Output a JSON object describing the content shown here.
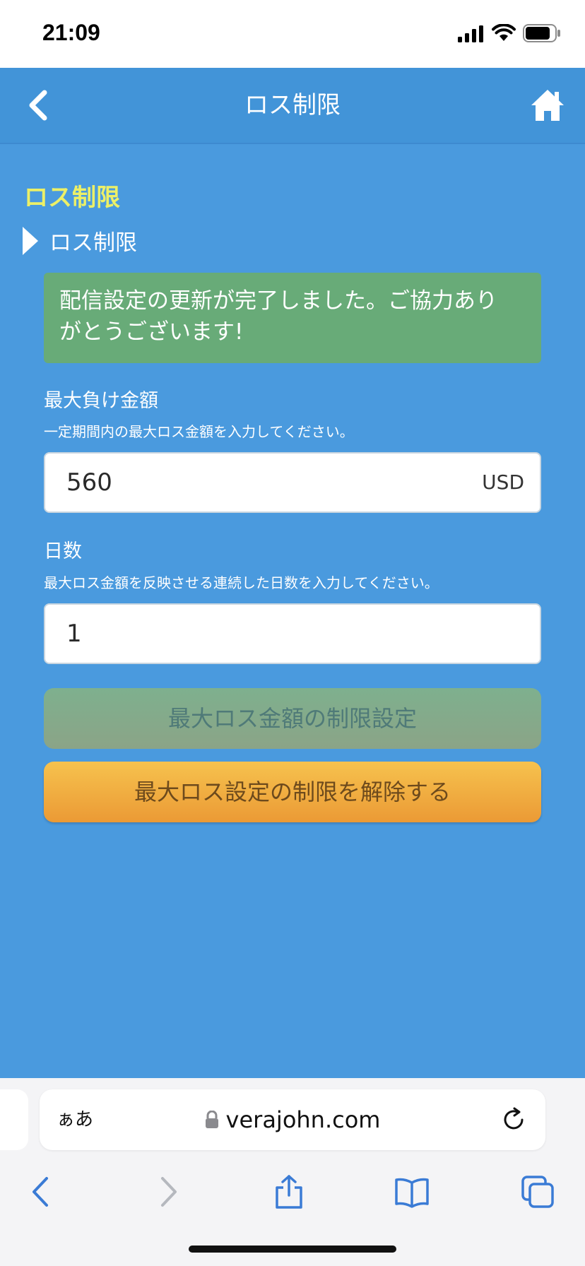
{
  "status_bar": {
    "time": "21:09"
  },
  "header": {
    "title": "ロス制限"
  },
  "content": {
    "section_title": "ロス制限",
    "sub_title": "ロス制限",
    "success_message_line1": "配信設定の更新が完了しました。ご協力あり",
    "success_message_line2": "がとうございます!",
    "max_loss": {
      "label": "最大負け金額",
      "hint": "一定期間内の最大ロス金額を入力してください。",
      "value": "560",
      "unit": "USD"
    },
    "days": {
      "label": "日数",
      "hint": "最大ロス金額を反映させる連続した日数を入力してください。",
      "value": "1"
    },
    "set_button_label": "最大ロス金額の制限設定",
    "release_button_label": "最大ロス設定の制限を解除する"
  },
  "browser": {
    "aa_label": "ぁあ",
    "url": "verajohn.com"
  },
  "colors": {
    "background": "#4a9ade",
    "header": "#4294d8",
    "section_title": "#ecf067",
    "success": "#68ab78",
    "release_button": "#f0ac40",
    "set_button": "#83aa8a",
    "browser_icon": "#3a7bd5"
  }
}
